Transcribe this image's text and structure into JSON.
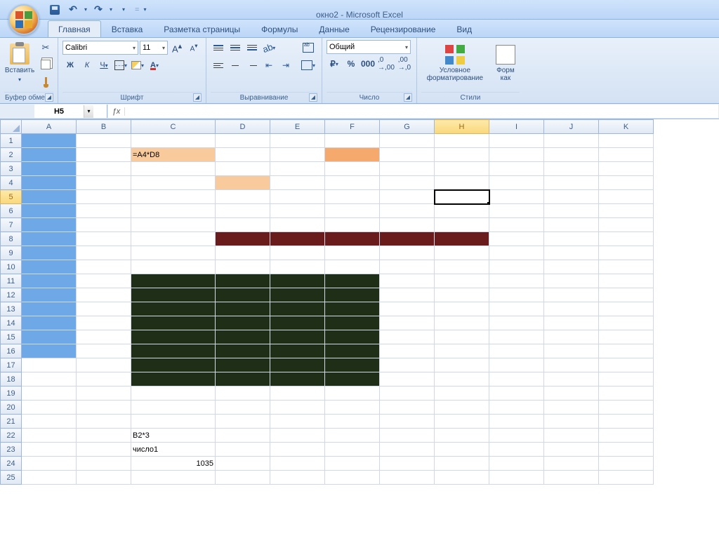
{
  "title": "окно2 - Microsoft Excel",
  "tabs": {
    "home": "Главная",
    "insert": "Вставка",
    "layout": "Разметка страницы",
    "formulas": "Формулы",
    "data": "Данные",
    "review": "Рецензирование",
    "view": "Вид"
  },
  "ribbon": {
    "clipboard": {
      "label": "Буфер обмена",
      "paste": "Вставить"
    },
    "font": {
      "label": "Шрифт",
      "name": "Calibri",
      "size": "11",
      "bold": "Ж",
      "italic": "К",
      "underline": "Ч",
      "grow": "A",
      "shrink": "A"
    },
    "alignment": {
      "label": "Выравнивание"
    },
    "number": {
      "label": "Число",
      "format": "Общий",
      "currency": "₽",
      "percent": "%",
      "comma": "000",
      "inc": ",00",
      "dec": ",0"
    },
    "styles": {
      "label": "Стили",
      "cond": "Условное форматирование",
      "fmt1": "Форм",
      "fmt2": "как"
    }
  },
  "namebox": "H5",
  "formula": "",
  "columns": [
    "A",
    "B",
    "C",
    "D",
    "E",
    "F",
    "G",
    "H",
    "I",
    "J",
    "K"
  ],
  "rows": [
    "1",
    "2",
    "3",
    "4",
    "5",
    "6",
    "7",
    "8",
    "9",
    "10",
    "11",
    "12",
    "13",
    "14",
    "15",
    "16",
    "17",
    "18",
    "19",
    "20",
    "21",
    "22",
    "23",
    "24",
    "25"
  ],
  "cells": {
    "C2": "=A4*D8",
    "C22": "B2*3",
    "C23": "число1",
    "C24": "1035"
  },
  "active_cell": "H5",
  "selected_col": "H",
  "selected_row": "5",
  "fills": {
    "blue": [
      "A1",
      "A2",
      "A3",
      "A4",
      "A5",
      "A6",
      "A7",
      "A8",
      "A9",
      "A10",
      "A11",
      "A12",
      "A13",
      "A14",
      "A15",
      "A16"
    ],
    "peach": [
      "C2",
      "D4"
    ],
    "orange": [
      "F2"
    ],
    "maroon": [
      "D8",
      "E8",
      "F8",
      "G8",
      "H8"
    ],
    "darkgreen": [
      "C11",
      "D11",
      "E11",
      "F11",
      "C12",
      "D12",
      "E12",
      "F12",
      "C13",
      "D13",
      "E13",
      "F13",
      "C14",
      "D14",
      "E14",
      "F14",
      "C15",
      "D15",
      "E15",
      "F15",
      "C16",
      "D16",
      "E16",
      "F16",
      "C17",
      "D17",
      "E17",
      "F17",
      "C18",
      "D18",
      "E18",
      "F18"
    ]
  }
}
